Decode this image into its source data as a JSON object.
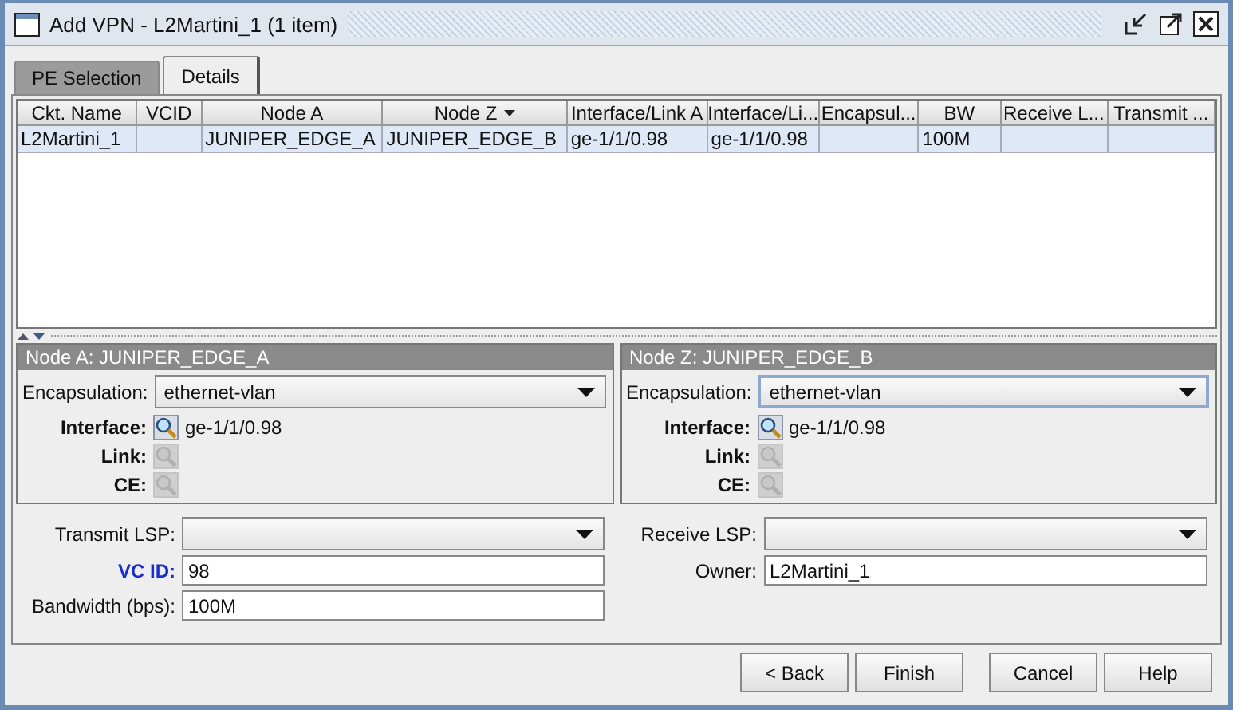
{
  "window": {
    "title": "Add VPN - L2Martini_1 (1 item)"
  },
  "tabs": [
    {
      "label": "PE Selection",
      "selected": false
    },
    {
      "label": "Details",
      "selected": true
    }
  ],
  "table": {
    "columns": [
      {
        "label": "Ckt. Name",
        "sorted": false
      },
      {
        "label": "VCID",
        "sorted": false
      },
      {
        "label": "Node A",
        "sorted": false
      },
      {
        "label": "Node Z",
        "sorted": true
      },
      {
        "label": "Interface/Link A",
        "sorted": false
      },
      {
        "label": "Interface/Li...",
        "sorted": false
      },
      {
        "label": "Encapsul...",
        "sorted": false
      },
      {
        "label": "BW",
        "sorted": false
      },
      {
        "label": "Receive L...",
        "sorted": false
      },
      {
        "label": "Transmit ...",
        "sorted": false
      }
    ],
    "rows": [
      {
        "selected": true,
        "cells": [
          "L2Martini_1",
          null,
          "JUNIPER_EDGE_A",
          "JUNIPER_EDGE_B",
          "ge-1/1/0.98",
          "ge-1/1/0.98",
          null,
          "100M",
          null,
          null
        ]
      }
    ]
  },
  "nodes": [
    {
      "title": "Node A: JUNIPER_EDGE_A",
      "encapsulation": {
        "label": "Encapsulation:",
        "value": "ethernet-vlan",
        "focused": false
      },
      "lookups": [
        {
          "label": "Interface:",
          "enabled": true,
          "value": "ge-1/1/0.98"
        },
        {
          "label": "Link:",
          "enabled": false
        },
        {
          "label": "CE:",
          "enabled": false
        }
      ]
    },
    {
      "title": "Node Z: JUNIPER_EDGE_B",
      "encapsulation": {
        "label": "Encapsulation:",
        "value": "ethernet-vlan",
        "focused": true
      },
      "lookups": [
        {
          "label": "Interface:",
          "enabled": true,
          "value": "ge-1/1/0.98"
        },
        {
          "label": "Link:",
          "enabled": false
        },
        {
          "label": "CE:",
          "enabled": false
        }
      ]
    }
  ],
  "form": {
    "left": [
      {
        "kind": "dropdown",
        "label": "Transmit LSP:",
        "required": false
      },
      {
        "kind": "text",
        "label": "VC ID:",
        "value": "98",
        "required": true
      },
      {
        "kind": "text",
        "label": "Bandwidth (bps):",
        "value": "100M",
        "required": false
      }
    ],
    "right": [
      {
        "kind": "dropdown",
        "label": "Receive LSP:",
        "required": false
      },
      {
        "kind": "text",
        "label": "Owner:",
        "value": "L2Martini_1",
        "required": false
      }
    ]
  },
  "nav_buttons": [
    {
      "label": "< Back"
    },
    {
      "label": "Finish"
    }
  ],
  "dialog_buttons": [
    {
      "label": "Cancel"
    },
    {
      "label": "Help"
    }
  ]
}
